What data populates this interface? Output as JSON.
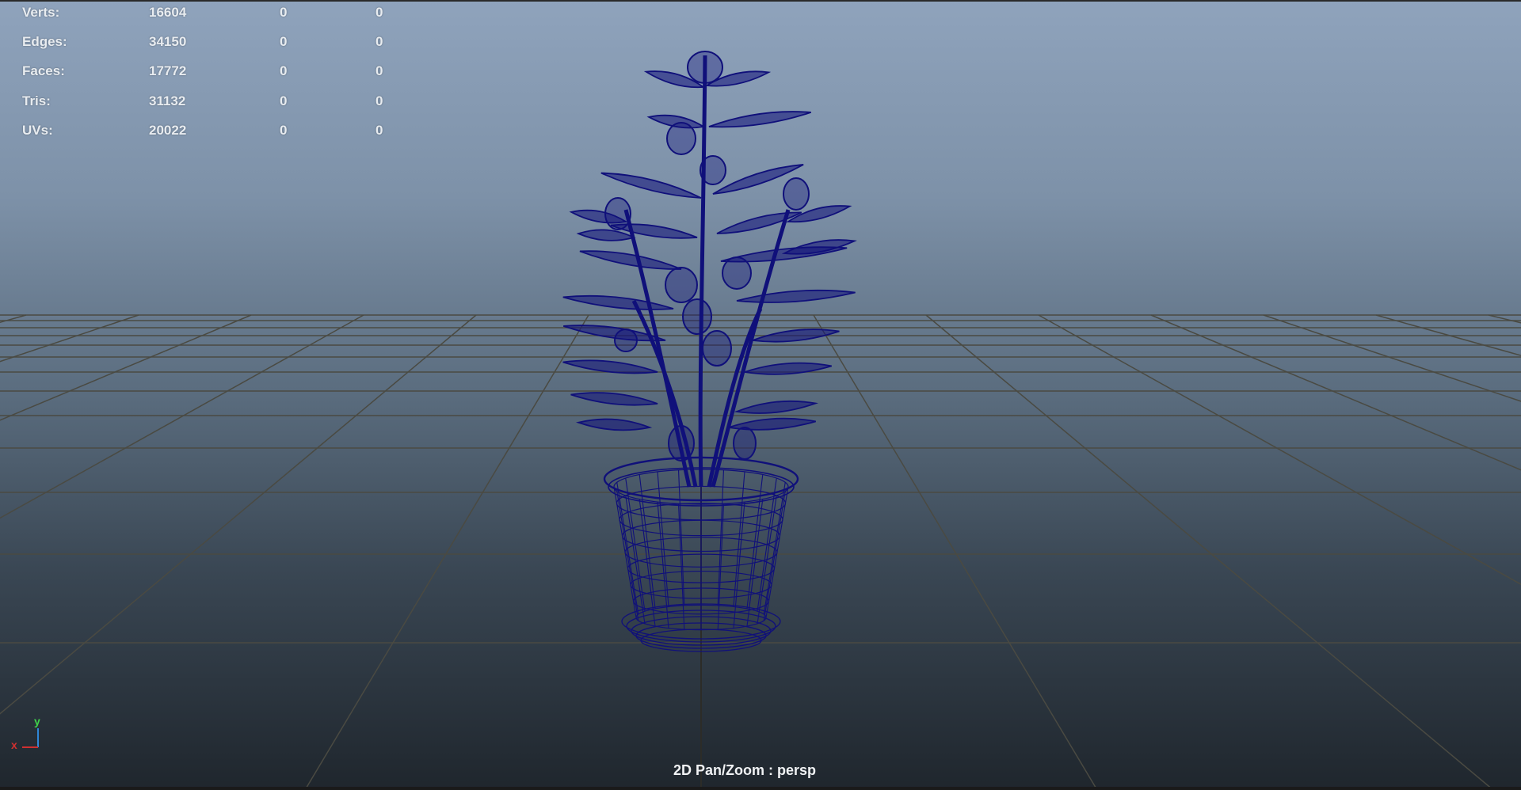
{
  "hud": {
    "rows": [
      {
        "label": "Verts:",
        "v1": "16604",
        "v2": "0",
        "v3": "0"
      },
      {
        "label": "Edges:",
        "v1": "34150",
        "v2": "0",
        "v3": "0"
      },
      {
        "label": "Faces:",
        "v1": "17772",
        "v2": "0",
        "v3": "0"
      },
      {
        "label": "Tris:",
        "v1": "31132",
        "v2": "0",
        "v3": "0"
      },
      {
        "label": "UVs:",
        "v1": "20022",
        "v2": "0",
        "v3": "0"
      }
    ]
  },
  "viewport": {
    "status_label": "2D Pan/Zoom : persp",
    "axis": {
      "x_label": "x",
      "y_label": "y"
    },
    "wireframe_color": "#10107a",
    "grid_color": "#4a4a42"
  }
}
